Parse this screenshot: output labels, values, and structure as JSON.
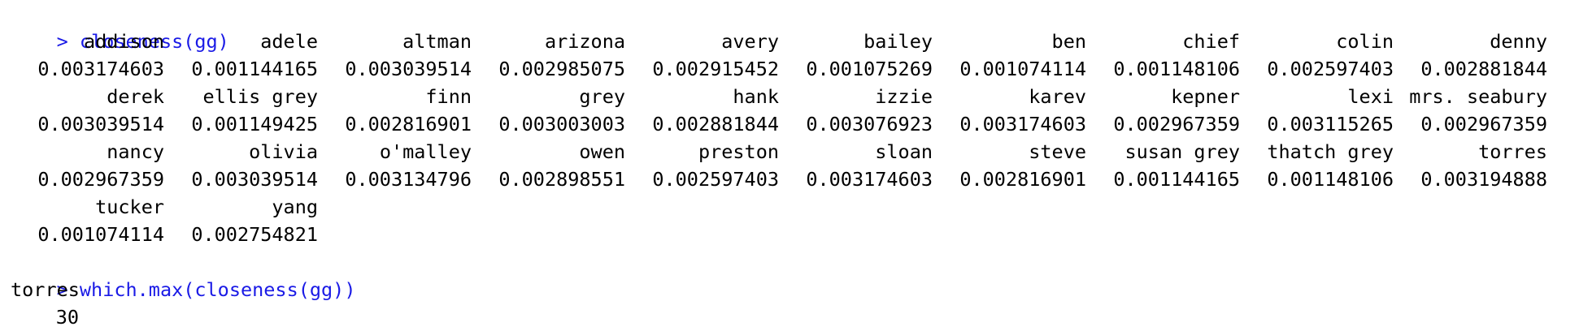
{
  "console": {
    "prompt": ">",
    "command1": "closeness(gg)",
    "rows": [
      {
        "names": [
          "addison",
          "adele",
          "altman",
          "arizona",
          "avery",
          "bailey",
          "ben",
          "chief",
          "colin",
          "denny"
        ],
        "values": [
          "0.003174603",
          "0.001144165",
          "0.003039514",
          "0.002985075",
          "0.002915452",
          "0.001075269",
          "0.001074114",
          "0.001148106",
          "0.002597403",
          "0.002881844"
        ]
      },
      {
        "names": [
          "derek",
          "ellis grey",
          "finn",
          "grey",
          "hank",
          "izzie",
          "karev",
          "kepner",
          "lexi",
          "mrs. seabury"
        ],
        "values": [
          "0.003039514",
          "0.001149425",
          "0.002816901",
          "0.003003003",
          "0.002881844",
          "0.003076923",
          "0.003174603",
          "0.002967359",
          "0.003115265",
          "0.002967359"
        ]
      },
      {
        "names": [
          "nancy",
          "olivia",
          "o'malley",
          "owen",
          "preston",
          "sloan",
          "steve",
          "susan grey",
          "thatch grey",
          "torres"
        ],
        "values": [
          "0.002967359",
          "0.003039514",
          "0.003134796",
          "0.002898551",
          "0.002597403",
          "0.003174603",
          "0.002816901",
          "0.001144165",
          "0.001148106",
          "0.003194888"
        ]
      },
      {
        "names": [
          "tucker",
          "yang"
        ],
        "values": [
          "0.001074114",
          "0.002754821"
        ]
      }
    ],
    "command2": "which.max(closeness(gg))",
    "result_name": "torres",
    "result_value": "30"
  }
}
